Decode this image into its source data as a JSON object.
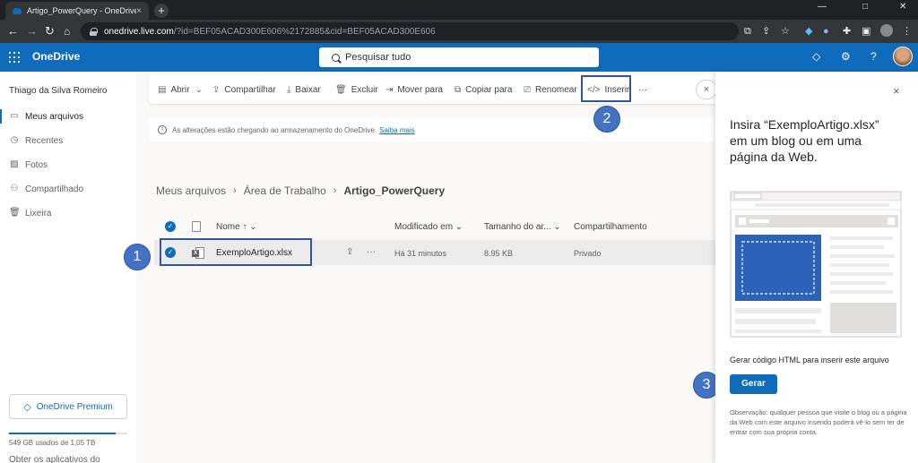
{
  "browser": {
    "tab_title": "Artigo_PowerQuery - OneDrive",
    "tab_close": "×",
    "new_tab": "+",
    "url_host": "onedrive.live.com",
    "url_rest": "/?id=BEF05ACAD300E606%2172885&cid=BEF05ACAD300E606"
  },
  "header": {
    "brand": "OneDrive",
    "search_placeholder": "Pesquisar tudo"
  },
  "leftnav": {
    "user_name": "Thiago da Silva Romeiro",
    "items": [
      {
        "label": "Meus arquivos"
      },
      {
        "label": "Recentes"
      },
      {
        "label": "Fotos"
      },
      {
        "label": "Compartilhado"
      },
      {
        "label": "Lixeira"
      }
    ],
    "premium_label": "OneDrive Premium",
    "storage_text": "549 GB usados de 1,05 TB",
    "get_apps": "Obter os aplicativos do"
  },
  "toolbar": {
    "open": "Abrir",
    "share": "Compartilhar",
    "download": "Baixar",
    "delete": "Excluir",
    "move": "Mover para",
    "copy": "Copiar para",
    "rename": "Renomear",
    "embed": "Inserir",
    "more": "···",
    "close": "×"
  },
  "notice": {
    "text": "As alterações estão chegando ao armazenamento do OneDrive.",
    "link": "Saiba mais"
  },
  "breadcrumb": {
    "items": [
      "Meus arquivos",
      "Área de Trabalho"
    ],
    "current": "Artigo_PowerQuery",
    "separator": "›"
  },
  "list": {
    "headers": {
      "name": "Nome ↑ ⌄",
      "modified": "Modificado em ⌄",
      "size": "Tamanho do ar... ⌄",
      "sharing": "Compartilhamento"
    },
    "rows": [
      {
        "name": "ExemploArtigo.xlsx",
        "modified": "Há 31 minutos",
        "size": "8.95 KB",
        "sharing": "Privado",
        "more": "···"
      }
    ]
  },
  "markers": {
    "one": "1",
    "two": "2",
    "three": "3"
  },
  "panel": {
    "close": "×",
    "title": "Insira “ExemploArtigo.xlsx” em um blog ou em uma página da Web.",
    "description": "Gerar código HTML para inserir este arquivo",
    "button": "Gerar",
    "note": "Observação: qualquer pessoa que visite o blog ou a página da Web com este arquivo inserido poderá vê-lo sem ter de entrar com sua própria conta."
  },
  "colors": {
    "brand_blue": "#0f6cbd",
    "marker_blue": "#4472c4",
    "highlight_border": "#2f5597"
  }
}
